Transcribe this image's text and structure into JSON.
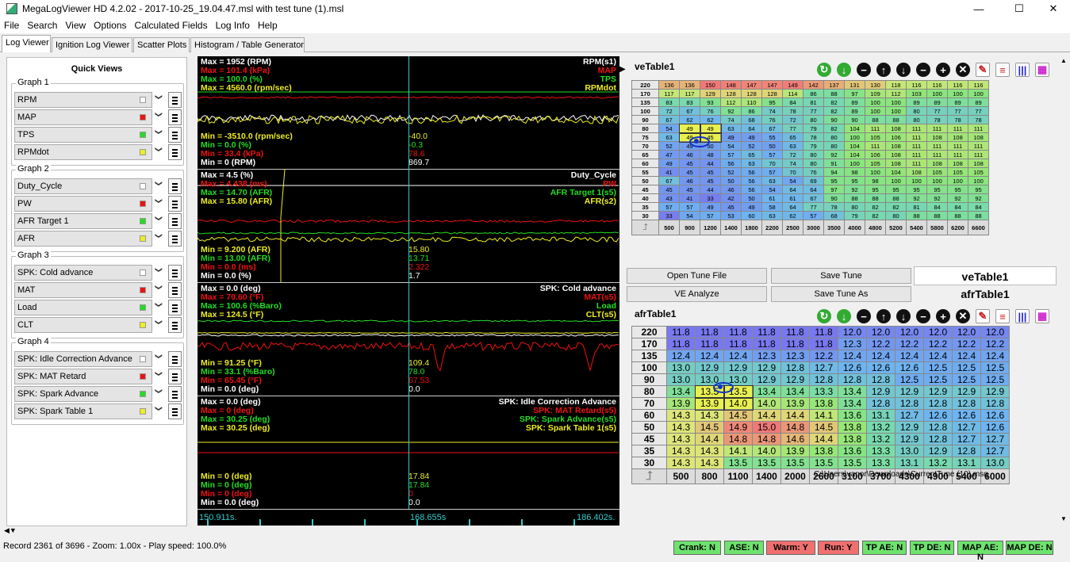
{
  "window": {
    "title": "MegaLogViewer HD 4.2.02 - 2017-10-25_19.04.47.msl with test tune (1).msl",
    "minimize": "—",
    "maximize": "☐",
    "close": "✕"
  },
  "menu": [
    "File",
    "Search",
    "View",
    "Options",
    "Calculated Fields",
    "Log Info",
    "Help"
  ],
  "tabs": [
    "Log Viewer",
    "Ignition Log Viewer",
    "Scatter Plots",
    "Histogram / Table Generator"
  ],
  "quick_views": {
    "title": "Quick Views",
    "groups": [
      {
        "label": "Graph 1",
        "items": [
          {
            "name": "RPM",
            "color": "#ffffff"
          },
          {
            "name": "MAP",
            "color": "#ee1111"
          },
          {
            "name": "TPS",
            "color": "#22dd22"
          },
          {
            "name": "RPMdot",
            "color": "#eeee22"
          }
        ]
      },
      {
        "label": "Graph 2",
        "items": [
          {
            "name": "Duty_Cycle",
            "color": "#ffffff"
          },
          {
            "name": "PW",
            "color": "#ee1111"
          },
          {
            "name": "AFR Target 1",
            "color": "#22dd22"
          },
          {
            "name": "AFR",
            "color": "#eeee22"
          }
        ]
      },
      {
        "label": "Graph 3",
        "items": [
          {
            "name": "SPK: Cold advance",
            "color": "#ffffff"
          },
          {
            "name": "MAT",
            "color": "#ee1111"
          },
          {
            "name": "Load",
            "color": "#22dd22"
          },
          {
            "name": "CLT",
            "color": "#eeee22"
          }
        ]
      },
      {
        "label": "Graph 4",
        "items": [
          {
            "name": "SPK: Idle Correction Advance",
            "color": "#ffffff"
          },
          {
            "name": "SPK: MAT Retard",
            "color": "#ee1111"
          },
          {
            "name": "SPK: Spark Advance",
            "color": "#22dd22"
          },
          {
            "name": "SPK: Spark Table 1",
            "color": "#eeee22"
          }
        ]
      }
    ]
  },
  "graph_panels": [
    {
      "max": [
        "Max = 1952 (RPM)",
        "Max = 101.4 (kPa)",
        "Max = 100.0 (%)",
        "Max = 4560.0 (rpm/sec)"
      ],
      "names": [
        "RPM(s1)",
        "MAP",
        "TPS",
        "RPMdot"
      ],
      "min": [
        "Min = -3510.0 (rpm/sec)",
        "Min = 0.0 (%)",
        "Min = 33.4 (kPa)",
        "Min = 0 (RPM)"
      ],
      "values": [
        "-40.0",
        "-0.3",
        "78.6",
        "869.7"
      ],
      "min_colors": [
        "#eeee22",
        "#22dd22",
        "#ee1111",
        "#ffffff"
      ]
    },
    {
      "max": [
        "Max = 4.5 (%)",
        "Max = 4.438 (ms)",
        "Max = 14.70 (AFR)",
        "Max = 15.80 (AFR)"
      ],
      "names": [
        "Duty_Cycle",
        "PW",
        "AFR Target 1(s5)",
        "AFR(s2)"
      ],
      "min": [
        "Min = 9.200 (AFR)",
        "Min = 13.00 (AFR)",
        "Min = 0.0 (ms)",
        "Min = 0.0 (%)"
      ],
      "values": [
        "15.80",
        "13.71",
        "2.322",
        "1.7"
      ],
      "min_colors": [
        "#eeee22",
        "#22dd22",
        "#ee1111",
        "#ffffff"
      ]
    },
    {
      "max": [
        "Max = 0.0 (deg)",
        "Max = 70.60 (°F)",
        "Max = 100.6 (%Baro)",
        "Max = 124.5 (°F)"
      ],
      "names": [
        "SPK: Cold advance",
        "MAT(s5)",
        "Load",
        "CLT(s5)"
      ],
      "min": [
        "Min = 91.25 (°F)",
        "Min = 33.1 (%Baro)",
        "Min = 65.45 (°F)",
        "Min = 0.0 (deg)"
      ],
      "values": [
        "109.4",
        "78.0",
        "67.53",
        "0.0"
      ],
      "min_colors": [
        "#eeee22",
        "#22dd22",
        "#ee1111",
        "#ffffff"
      ]
    },
    {
      "max": [
        "Max = 0.0 (deg)",
        "Max = 0 (deg)",
        "Max = 30.25 (deg)",
        "Max = 30.25 (deg)"
      ],
      "names": [
        "SPK: Idle Correction Advance",
        "SPK: MAT Retard(s5)",
        "SPK: Spark Advance(s5)",
        "SPK: Spark Table 1(s5)"
      ],
      "min": [
        "Min = 0 (deg)",
        "Min = 0 (deg)",
        "Min = 0 (deg)",
        "Min = 0.0 (deg)"
      ],
      "values": [
        "17.84",
        "17.84",
        "0",
        "0.0"
      ],
      "min_colors": [
        "#eeee22",
        "#22dd22",
        "#ee1111",
        "#ffffff"
      ]
    }
  ],
  "max_colors": [
    "#ffffff",
    "#ee1111",
    "#22dd22",
    "#eeee22"
  ],
  "time_axis": [
    "150.911s.",
    "168.655s",
    "186.402s."
  ],
  "ve_table": {
    "title": "veTable1",
    "rows": [
      220,
      170,
      135,
      100,
      90,
      80,
      75,
      70,
      65,
      60,
      55,
      50,
      45,
      40,
      35,
      30
    ],
    "cols": [
      500,
      900,
      1200,
      1400,
      1800,
      2200,
      2500,
      3000,
      3500,
      4000,
      4800,
      5200,
      5400,
      5800,
      6200,
      6600
    ],
    "cells": [
      [
        136,
        136,
        150,
        148,
        147,
        147,
        149,
        142,
        137,
        131,
        130,
        118,
        116,
        116,
        116,
        116
      ],
      [
        117,
        117,
        129,
        128,
        128,
        128,
        114,
        86,
        88,
        97,
        109,
        112,
        103,
        100,
        100,
        100
      ],
      [
        83,
        83,
        93,
        112,
        110,
        95,
        84,
        81,
        82,
        89,
        100,
        100,
        89,
        89,
        89,
        89
      ],
      [
        72,
        67,
        76,
        92,
        86,
        74,
        78,
        77,
        82,
        89,
        100,
        100,
        80,
        77,
        77,
        77
      ],
      [
        67,
        62,
        62,
        74,
        68,
        76,
        72,
        80,
        90,
        90,
        88,
        88,
        80,
        78,
        78,
        78
      ],
      [
        54,
        49,
        49,
        63,
        64,
        67,
        77,
        79,
        82,
        104,
        111,
        108,
        111,
        111,
        111,
        111
      ],
      [
        63,
        49,
        45,
        49,
        49,
        55,
        65,
        78,
        80,
        100,
        105,
        106,
        111,
        108,
        108,
        108
      ],
      [
        52,
        49,
        50,
        54,
        52,
        50,
        63,
        79,
        80,
        104,
        111,
        108,
        111,
        111,
        111,
        111
      ],
      [
        47,
        46,
        48,
        57,
        65,
        57,
        72,
        80,
        92,
        104,
        106,
        108,
        111,
        111,
        111,
        111
      ],
      [
        49,
        45,
        44,
        56,
        63,
        70,
        74,
        80,
        91,
        100,
        105,
        108,
        111,
        108,
        108,
        108
      ],
      [
        41,
        45,
        45,
        52,
        56,
        57,
        70,
        76,
        94,
        98,
        100,
        104,
        108,
        105,
        105,
        105
      ],
      [
        67,
        46,
        45,
        50,
        56,
        63,
        54,
        69,
        95,
        95,
        98,
        100,
        100,
        100,
        100,
        100
      ],
      [
        45,
        45,
        44,
        46,
        56,
        54,
        64,
        64,
        97,
        92,
        95,
        95,
        95,
        95,
        95,
        95
      ],
      [
        43,
        41,
        33,
        42,
        50,
        61,
        61,
        67,
        90,
        88,
        88,
        88,
        92,
        92,
        92,
        92
      ],
      [
        57,
        57,
        49,
        45,
        49,
        58,
        64,
        77,
        78,
        80,
        82,
        82,
        81,
        84,
        84,
        84
      ],
      [
        33,
        54,
        57,
        53,
        60,
        63,
        62,
        57,
        68,
        79,
        82,
        80,
        88,
        88,
        88,
        88
      ]
    ]
  },
  "buttons": {
    "open_tune": "Open Tune File",
    "save_tune": "Save Tune",
    "ve_analyze": "VE Analyze",
    "save_tune_as": "Save Tune As"
  },
  "right_tabs": [
    "veTable1",
    "afrTable1"
  ],
  "afr_table": {
    "title": "afrTable1",
    "rows": [
      220,
      170,
      135,
      100,
      90,
      80,
      70,
      60,
      50,
      45,
      35,
      30
    ],
    "cols": [
      500,
      800,
      1100,
      1400,
      2000,
      2600,
      3100,
      3700,
      4300,
      4900,
      5400,
      6000
    ],
    "cells": [
      [
        "11.8",
        "11.8",
        "11.8",
        "11.8",
        "11.8",
        "11.8",
        "12.0",
        "12.0",
        "12.0",
        "12.0",
        "12.0",
        "12.0"
      ],
      [
        "11.8",
        "11.8",
        "11.8",
        "11.8",
        "11.8",
        "11.8",
        "12.3",
        "12.2",
        "12.2",
        "12.2",
        "12.2",
        "12.2"
      ],
      [
        "12.4",
        "12.4",
        "12.4",
        "12.3",
        "12.3",
        "12.2",
        "12.4",
        "12.4",
        "12.4",
        "12.4",
        "12.4",
        "12.4"
      ],
      [
        "13.0",
        "12.9",
        "12.9",
        "12.9",
        "12.8",
        "12.7",
        "12.6",
        "12.6",
        "12.6",
        "12.5",
        "12.5",
        "12.5"
      ],
      [
        "13.0",
        "13.0",
        "13.0",
        "12.9",
        "12.9",
        "12.8",
        "12.8",
        "12.8",
        "12.5",
        "12.5",
        "12.5",
        "12.5"
      ],
      [
        "13.4",
        "13.5",
        "13.5",
        "13.4",
        "13.4",
        "13.3",
        "13.4",
        "12.9",
        "12.9",
        "12.9",
        "12.9",
        "12.9"
      ],
      [
        "13.9",
        "13.9",
        "14.0",
        "14.0",
        "13.9",
        "13.8",
        "13.4",
        "12.8",
        "12.8",
        "12.8",
        "12.8",
        "12.8"
      ],
      [
        "14.3",
        "14.3",
        "14.5",
        "14.4",
        "14.4",
        "14.1",
        "13.6",
        "13.1",
        "12.7",
        "12.6",
        "12.6",
        "12.6"
      ],
      [
        "14.3",
        "14.5",
        "14.9",
        "15.0",
        "14.8",
        "14.5",
        "13.8",
        "13.2",
        "12.9",
        "12.8",
        "12.7",
        "12.6"
      ],
      [
        "14.3",
        "14.4",
        "14.8",
        "14.8",
        "14.6",
        "14.4",
        "13.8",
        "13.2",
        "12.9",
        "12.8",
        "12.7",
        "12.7"
      ],
      [
        "14.3",
        "14.3",
        "14.1",
        "14.0",
        "13.9",
        "13.8",
        "13.6",
        "13.3",
        "13.0",
        "12.9",
        "12.8",
        "12.7"
      ],
      [
        "14.3",
        "14.3",
        "13.5",
        "13.5",
        "13.5",
        "13.5",
        "13.5",
        "13.3",
        "13.1",
        "13.2",
        "13.1",
        "13.0"
      ]
    ]
  },
  "tune_path": "C:\\Users\\vanor\\Downloads\\CurrentTune (10).msq",
  "status": {
    "record": "Record 2361 of 3696 - Zoom: 1.00x - Play speed: 100.0%",
    "badges": [
      {
        "label": "Crank: N",
        "color": "#6ee36e"
      },
      {
        "label": "ASE: N",
        "color": "#6ee36e"
      },
      {
        "label": "Warm: Y",
        "color": "#f07070"
      },
      {
        "label": "Run: Y",
        "color": "#f07070"
      },
      {
        "label": "TP AE: N",
        "color": "#6ee36e"
      },
      {
        "label": "TP DE: N",
        "color": "#6ee36e"
      },
      {
        "label": "MAP AE: N",
        "color": "#6ee36e"
      },
      {
        "label": "MAP DE: N",
        "color": "#6ee36e"
      }
    ]
  }
}
